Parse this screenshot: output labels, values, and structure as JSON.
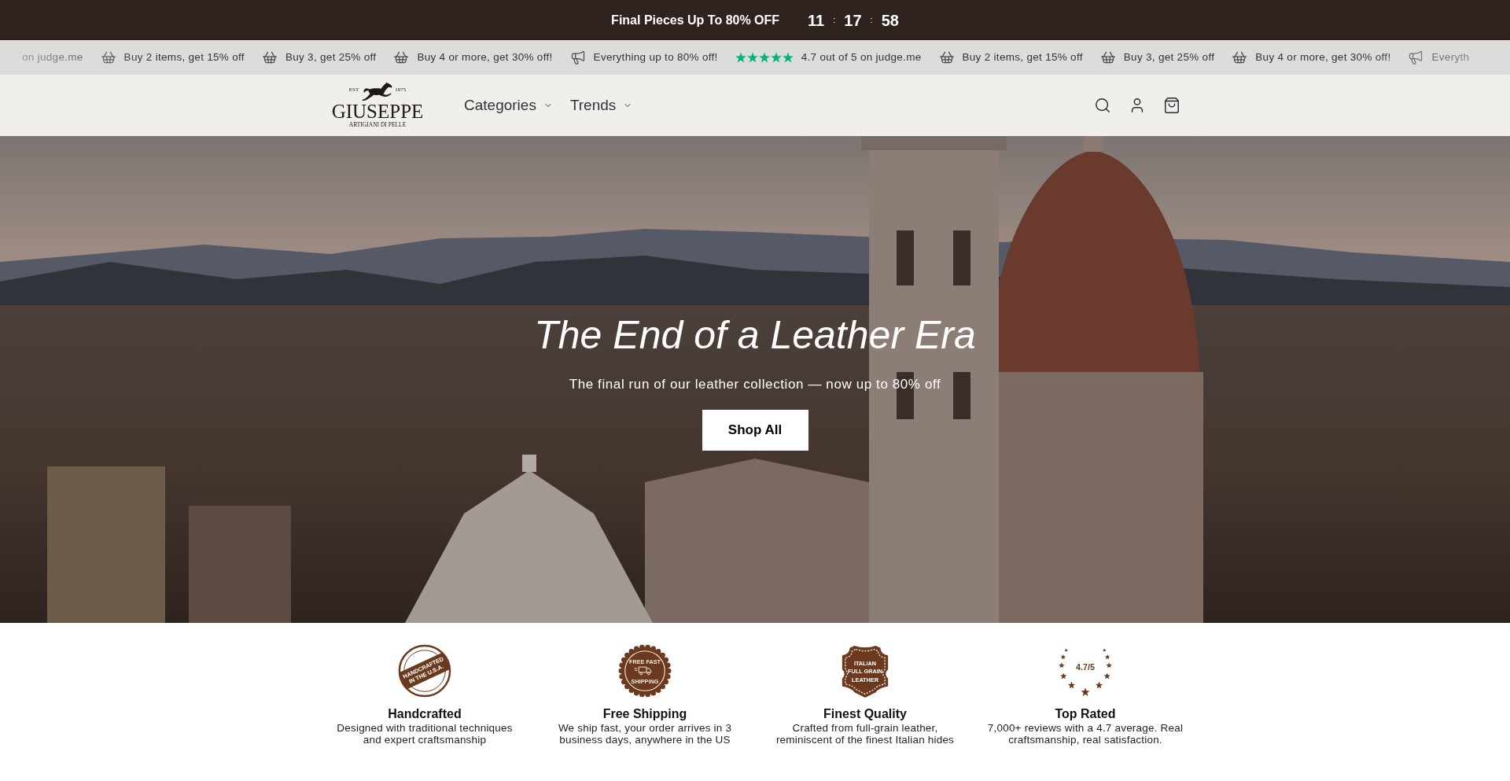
{
  "announcement": {
    "title": "Final Pieces Up To 80% OFF",
    "countdown": [
      {
        "kind": "number",
        "text": "11"
      },
      {
        "kind": "separator",
        "text": ":"
      },
      {
        "kind": "number",
        "text": "17"
      },
      {
        "kind": "separator",
        "text": ":"
      },
      {
        "kind": "number",
        "text": "58"
      }
    ]
  },
  "marquee": [
    {
      "kind": "plain",
      "text": "on judge.me"
    },
    {
      "kind": "basket",
      "text": "Buy 2 items, get 15% off"
    },
    {
      "kind": "basket",
      "text": "Buy 3, get 25% off"
    },
    {
      "kind": "basket",
      "text": "Buy 4 or more, get 30% off!"
    },
    {
      "kind": "megaphone",
      "text": "Everything up to 80% off!"
    },
    {
      "kind": "rating",
      "stars": 5,
      "text": "4.7 out of 5 on judge.me"
    },
    {
      "kind": "basket",
      "text": "Buy 2 items, get 15% off"
    },
    {
      "kind": "basket",
      "text": "Buy 3, get 25% off"
    },
    {
      "kind": "basket",
      "text": "Buy 4 or more, get 30% off!"
    },
    {
      "kind": "megaphone",
      "text": "Everyth"
    }
  ],
  "header": {
    "logo": {
      "est": "EST",
      "year": "1975",
      "name": "GIUSEPPE",
      "tagline": "ARTIGIANI DI PELLE"
    },
    "nav": [
      {
        "label": "Categories",
        "has_menu": true
      },
      {
        "label": "Trends",
        "has_menu": true
      }
    ],
    "actions": [
      {
        "kind": "search"
      },
      {
        "kind": "account"
      },
      {
        "kind": "cart"
      }
    ]
  },
  "hero": {
    "title": "The End of a Leather Era",
    "subtitle": "The final run of our leather collection — now up to 80% off",
    "button": "Shop All"
  },
  "features": [
    {
      "badge": {
        "kind": "stamp",
        "lines": [
          "HANDCRAFTED",
          "IN THE U.S.A."
        ]
      },
      "title": "Handcrafted",
      "description": "Designed with traditional techniques\nand expert craftsmanship"
    },
    {
      "badge": {
        "kind": "seal",
        "lines": [
          "FREE FAST",
          "SHIPPING"
        ]
      },
      "title": "Free Shipping",
      "description": "We ship fast, your order arrives in 3\nbusiness days, anywhere in the US"
    },
    {
      "badge": {
        "kind": "hide",
        "lines": [
          "ITALIAN",
          "FULL GRAIN",
          "LEATHER"
        ]
      },
      "title": "Finest Quality",
      "description": "Crafted from full-grain leather,\nreminiscent of the finest Italian hides"
    },
    {
      "badge": {
        "kind": "wreath",
        "lines": [
          "4.7/5"
        ]
      },
      "title": "Top Rated",
      "description": "7,000+ reviews with a 4.7 average. Real\ncraftsmanship, real satisfaction."
    }
  ]
}
